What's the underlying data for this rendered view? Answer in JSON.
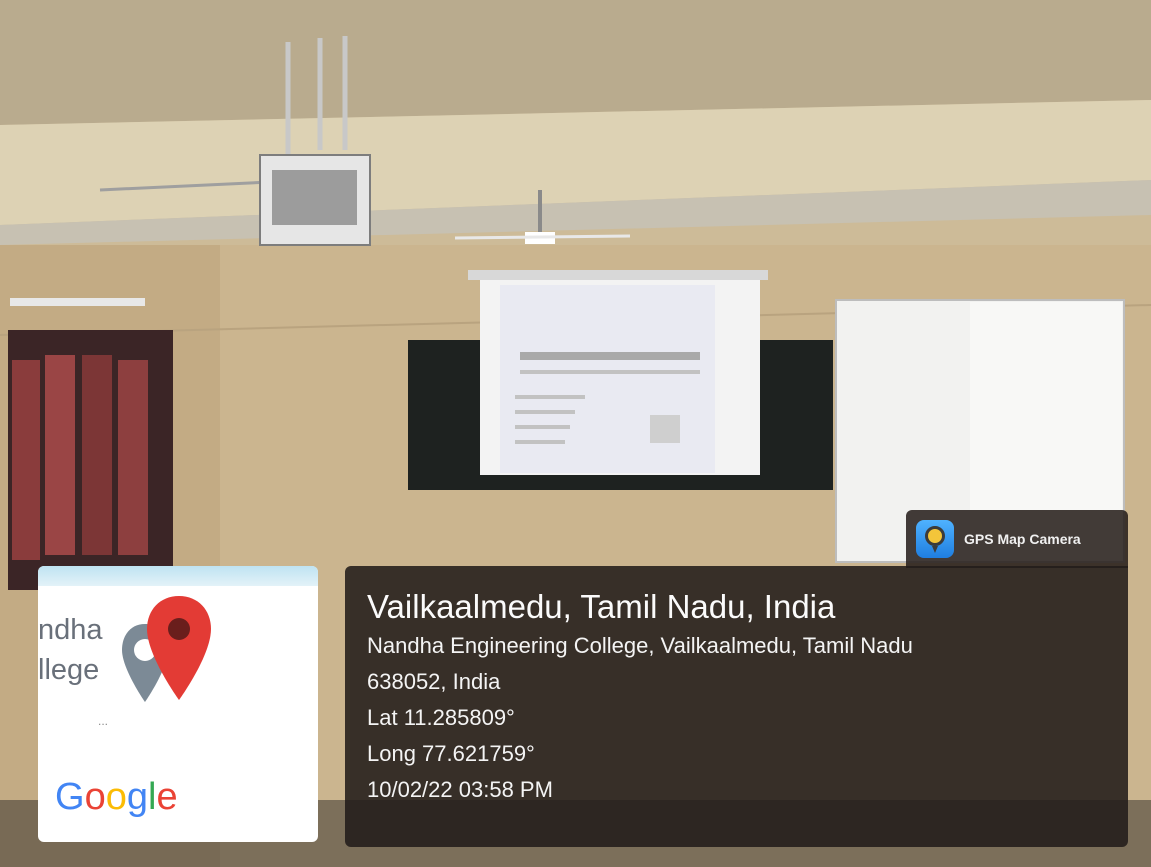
{
  "app": {
    "badge_label": "GPS Map Camera",
    "badge_icon": "gps-map-camera-icon"
  },
  "location": {
    "title": "Vailkaalmedu, Tamil Nadu, India",
    "address_line1": "Nandha Engineering College, Vailkaalmedu, Tamil Nadu",
    "address_line2": "638052, India",
    "lat": "Lat 11.285809°",
    "long": "Long 77.621759°",
    "datetime": "10/02/22 03:58 PM"
  },
  "map": {
    "label_line1": "ndha",
    "label_line2": "llege",
    "dots": "...",
    "brand": "Google",
    "marker_icon": "map-pin-icon",
    "place_icon": "college-place-icon"
  },
  "colors": {
    "overlay_bg": "#221c1a",
    "pin_red": "#e33b35",
    "google_blue": "#4285f4",
    "google_red": "#ea4335",
    "google_yellow": "#fbbc05",
    "google_green": "#34a853"
  }
}
